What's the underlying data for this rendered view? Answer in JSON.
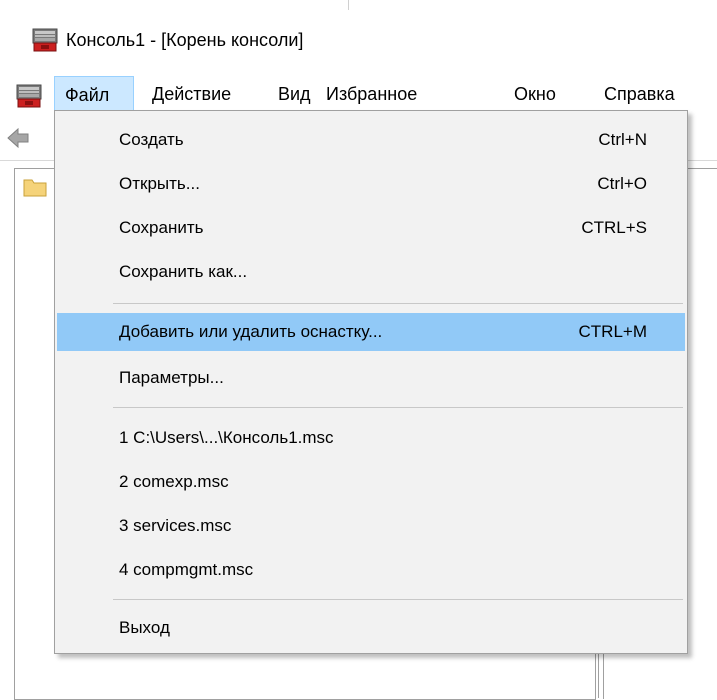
{
  "window": {
    "title": "Консоль1 - [Корень консоли]",
    "accent": "#cce8ff",
    "highlight": "#91c9f7"
  },
  "menubar": {
    "icon": "mmc-console-icon",
    "items": [
      {
        "label": "Файл"
      },
      {
        "label": "Действие"
      },
      {
        "label": "Вид"
      },
      {
        "label": "Избранное"
      },
      {
        "label": "Окно"
      },
      {
        "label": "Справка"
      }
    ]
  },
  "toolbar": {
    "icon": "back-arrow-icon"
  },
  "tree": {
    "icon": "folder-icon"
  },
  "file_menu": {
    "items": [
      {
        "label": "Создать",
        "shortcut": "Ctrl+N"
      },
      {
        "label": "Открыть...",
        "shortcut": "Ctrl+O"
      },
      {
        "label": "Сохранить",
        "shortcut": "CTRL+S"
      },
      {
        "label": "Сохранить как...",
        "shortcut": ""
      },
      {
        "label": "Добавить или удалить оснастку...",
        "shortcut": "CTRL+M"
      },
      {
        "label": "Параметры...",
        "shortcut": ""
      },
      {
        "label": "1 C:\\Users\\...\\Консоль1.msc",
        "shortcut": ""
      },
      {
        "label": "2 comexp.msc",
        "shortcut": ""
      },
      {
        "label": "3 services.msc",
        "shortcut": ""
      },
      {
        "label": "4 compmgmt.msc",
        "shortcut": ""
      },
      {
        "label": "Выход",
        "shortcut": ""
      }
    ]
  }
}
